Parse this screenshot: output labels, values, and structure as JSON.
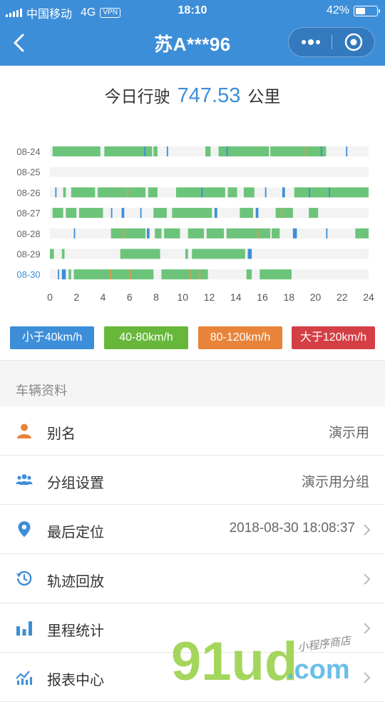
{
  "status_bar": {
    "carrier": "中国移动",
    "network": "4G",
    "vpn": "VPN",
    "time": "18:10",
    "battery": "42%"
  },
  "nav": {
    "title": "苏A***96"
  },
  "summary": {
    "prefix": "今日行驶",
    "value": "747.53",
    "unit": "公里"
  },
  "colors": {
    "blue": "#3d8ed8",
    "green": "#6cc47a",
    "orange": "#e69a4c",
    "red": "#d9414a",
    "track": "#f3f3f3"
  },
  "chart_data": {
    "type": "timeline",
    "x_ticks": [
      "0",
      "2",
      "4",
      "6",
      "8",
      "10",
      "12",
      "14",
      "16",
      "18",
      "20",
      "22",
      "24"
    ],
    "xlim": [
      0,
      24
    ],
    "rows": [
      {
        "date": "08-24",
        "segments": [
          [
            0.2,
            3.8,
            "g"
          ],
          [
            4.1,
            7.7,
            "g"
          ],
          [
            7.1,
            7.2,
            "b"
          ],
          [
            7.8,
            8.1,
            "g"
          ],
          [
            8.8,
            8.9,
            "b"
          ],
          [
            11.7,
            12.1,
            "g"
          ],
          [
            12.7,
            16.5,
            "g"
          ],
          [
            16.6,
            20.8,
            "g"
          ],
          [
            13.3,
            13.4,
            "b"
          ],
          [
            19.2,
            19.3,
            "o"
          ],
          [
            20.4,
            20.5,
            "b"
          ],
          [
            22.3,
            22.4,
            "b"
          ]
        ]
      },
      {
        "date": "08-25",
        "segments": []
      },
      {
        "date": "08-26",
        "segments": [
          [
            0.4,
            0.5,
            "b"
          ],
          [
            1.0,
            1.2,
            "g"
          ],
          [
            1.6,
            3.4,
            "g"
          ],
          [
            3.6,
            7.2,
            "g"
          ],
          [
            5.8,
            5.9,
            "o"
          ],
          [
            7.4,
            8.1,
            "g"
          ],
          [
            9.5,
            13.2,
            "g"
          ],
          [
            11.4,
            11.5,
            "b"
          ],
          [
            13.4,
            14.1,
            "g"
          ],
          [
            14.6,
            15.4,
            "g"
          ],
          [
            16.2,
            16.3,
            "b"
          ],
          [
            17.5,
            17.7,
            "b"
          ],
          [
            18.4,
            24.0,
            "g"
          ],
          [
            19.5,
            19.6,
            "b"
          ],
          [
            21.0,
            21.1,
            "b"
          ]
        ]
      },
      {
        "date": "08-27",
        "segments": [
          [
            0.2,
            1.0,
            "g"
          ],
          [
            1.2,
            2.0,
            "g"
          ],
          [
            2.2,
            4.0,
            "g"
          ],
          [
            4.6,
            4.7,
            "b"
          ],
          [
            5.4,
            5.6,
            "b"
          ],
          [
            6.8,
            6.9,
            "b"
          ],
          [
            7.8,
            8.8,
            "g"
          ],
          [
            9.2,
            12.2,
            "g"
          ],
          [
            12.4,
            12.6,
            "b"
          ],
          [
            14.3,
            15.3,
            "g"
          ],
          [
            15.5,
            15.7,
            "b"
          ],
          [
            17.0,
            18.3,
            "g"
          ],
          [
            19.5,
            20.2,
            "g"
          ],
          [
            17.4,
            17.5,
            "o"
          ]
        ]
      },
      {
        "date": "08-28",
        "segments": [
          [
            1.8,
            1.9,
            "b"
          ],
          [
            4.6,
            7.2,
            "g"
          ],
          [
            7.3,
            7.5,
            "b"
          ],
          [
            7.9,
            8.4,
            "g"
          ],
          [
            8.6,
            9.8,
            "g"
          ],
          [
            10.4,
            11.6,
            "g"
          ],
          [
            11.8,
            13.1,
            "g"
          ],
          [
            13.3,
            16.6,
            "g"
          ],
          [
            16.7,
            17.3,
            "g"
          ],
          [
            18.3,
            18.6,
            "b"
          ],
          [
            20.8,
            20.9,
            "b"
          ],
          [
            23.0,
            24.0,
            "g"
          ],
          [
            5.5,
            5.6,
            "o"
          ],
          [
            15.6,
            15.7,
            "o"
          ]
        ]
      },
      {
        "date": "08-29",
        "segments": [
          [
            0.0,
            0.3,
            "g"
          ],
          [
            0.9,
            1.1,
            "g"
          ],
          [
            5.3,
            8.3,
            "g"
          ],
          [
            10.2,
            10.4,
            "g"
          ],
          [
            10.7,
            14.7,
            "g"
          ],
          [
            14.9,
            15.2,
            "b"
          ]
        ]
      },
      {
        "date": "08-30",
        "segments": [
          [
            0.6,
            0.7,
            "b"
          ],
          [
            0.9,
            1.2,
            "b"
          ],
          [
            1.4,
            1.6,
            "g"
          ],
          [
            1.8,
            7.8,
            "g"
          ],
          [
            4.5,
            4.6,
            "o"
          ],
          [
            6.0,
            6.1,
            "o"
          ],
          [
            8.4,
            11.9,
            "g"
          ],
          [
            10.5,
            10.6,
            "o"
          ],
          [
            11.2,
            11.3,
            "o"
          ],
          [
            14.8,
            15.2,
            "g"
          ],
          [
            15.8,
            18.2,
            "g"
          ]
        ]
      }
    ]
  },
  "legend": [
    {
      "label": "小于40km/h",
      "color": "#3d8ed8"
    },
    {
      "label": "40-80km/h",
      "color": "#67b83a"
    },
    {
      "label": "80-120km/h",
      "color": "#e8843a"
    },
    {
      "label": "大于120km/h",
      "color": "#d43f46"
    }
  ],
  "section_title": "车辆资料",
  "list": [
    {
      "label": "别名",
      "value": "演示用",
      "icon": "person-icon",
      "arrow": false
    },
    {
      "label": "分组设置",
      "value": "演示用分组",
      "icon": "group-icon",
      "arrow": false
    },
    {
      "label": "最后定位",
      "value": "2018-08-30 18:08:37",
      "icon": "location-pin-icon",
      "arrow": true
    },
    {
      "label": "轨迹回放",
      "value": "",
      "icon": "history-icon",
      "arrow": true
    },
    {
      "label": "里程统计",
      "value": "",
      "icon": "bar-chart-icon",
      "arrow": true
    },
    {
      "label": "报表中心",
      "value": "",
      "icon": "report-icon",
      "arrow": true
    }
  ],
  "watermark": {
    "brand": "91ud",
    "suffix": ".com",
    "tagline": "小程序商店"
  }
}
